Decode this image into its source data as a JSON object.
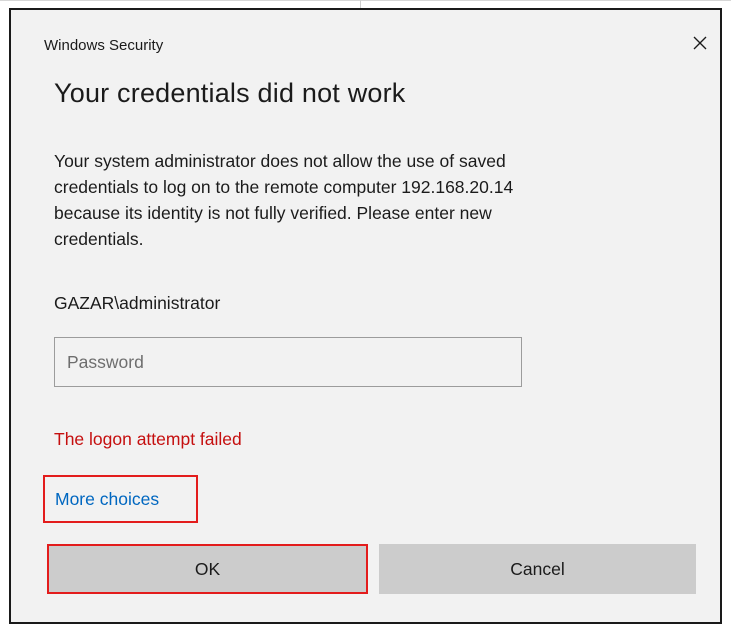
{
  "dialog": {
    "caption": "Windows Security",
    "close_icon": "close-icon",
    "title": "Your credentials did not work",
    "message_lines": [
      "Your system administrator does not allow the use of saved",
      "credentials to log on to the remote computer 192.168.20.14",
      "because its identity is not fully verified. Please enter new",
      "credentials."
    ],
    "username": "GAZAR\\administrator",
    "password": {
      "value": "",
      "placeholder": "Password"
    },
    "error_text": "The logon attempt failed",
    "more_choices_label": "More choices",
    "ok_label": "OK",
    "cancel_label": "Cancel"
  },
  "colors": {
    "dialog_background": "#f2f2f2",
    "error": "#c50f0f",
    "link": "#0067c0",
    "button": "#cccccc",
    "highlight_box": "#e31c1c"
  }
}
